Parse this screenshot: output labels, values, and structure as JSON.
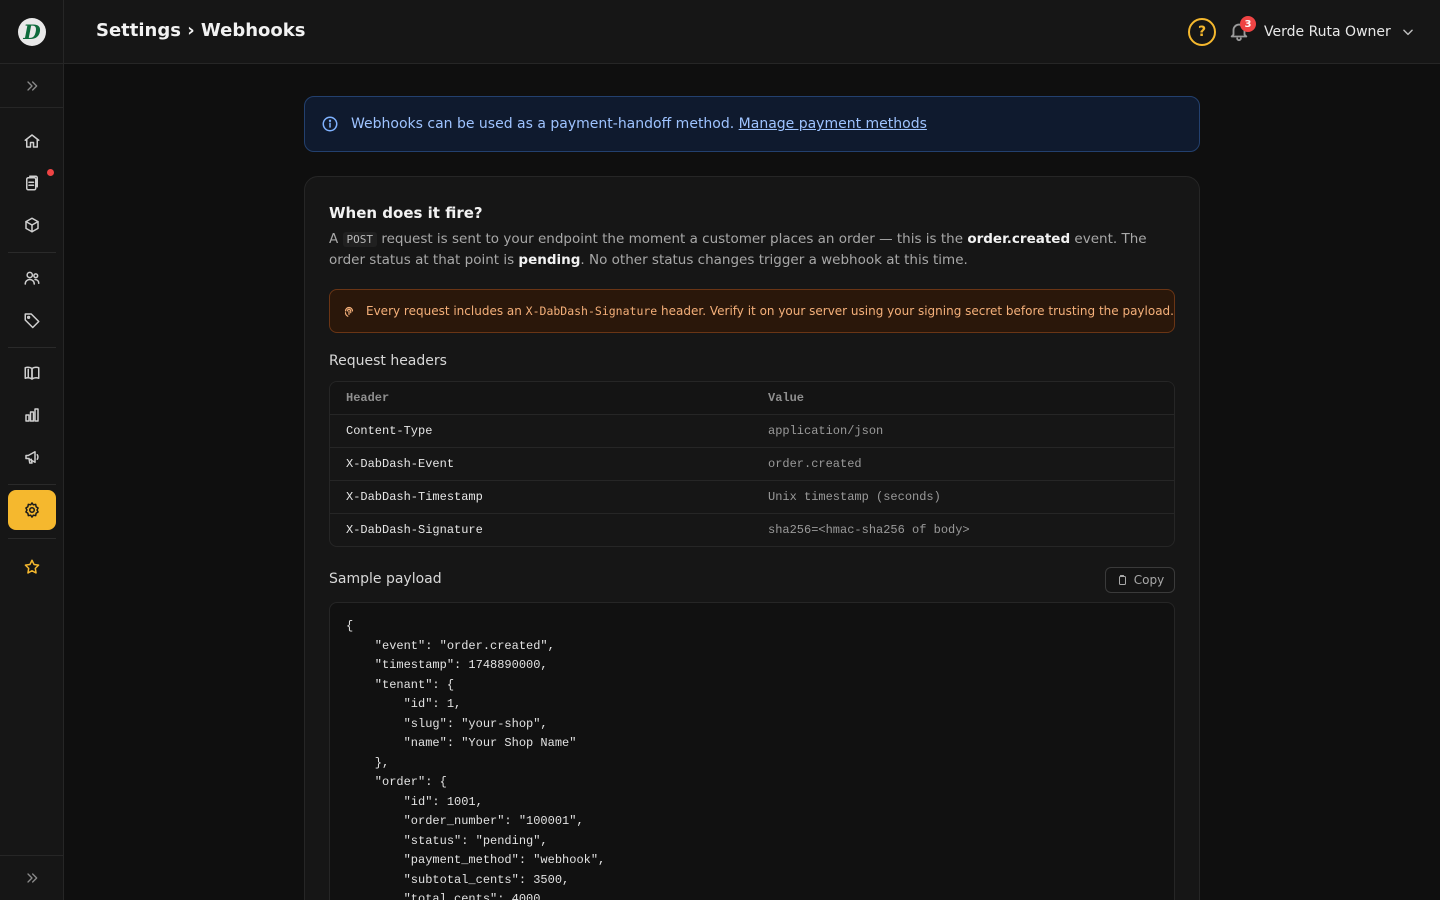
{
  "app": {
    "logo_letter": "D",
    "page_title": "Settings › Webhooks",
    "colors": {
      "accent": "#f5b82e",
      "notification": "#ef4444"
    }
  },
  "header": {
    "help_icon": "question-circle-icon",
    "notification_count": "3",
    "user_name": "Verde Ruta Owner"
  },
  "sidebar": {
    "items": [
      {
        "name": "home",
        "icon": "home-icon"
      },
      {
        "name": "orders",
        "icon": "clipboard-icon",
        "has_dot": true
      },
      {
        "name": "products",
        "icon": "box-icon"
      },
      {
        "name": "customers",
        "icon": "users-icon"
      },
      {
        "name": "discounts",
        "icon": "tag-icon"
      },
      {
        "name": "docs",
        "icon": "book-icon"
      },
      {
        "name": "analytics",
        "icon": "bar-chart-icon"
      },
      {
        "name": "marketing",
        "icon": "megaphone-icon"
      },
      {
        "name": "settings",
        "icon": "gear-icon",
        "active": true
      },
      {
        "name": "favorites",
        "icon": "star-icon"
      }
    ]
  },
  "banner": {
    "text": "Webhooks can be used as a payment-handoff method. ",
    "link": "Manage payment methods"
  },
  "fire": {
    "title": "When does it fire?",
    "desc_a": "A ",
    "desc_code": "POST",
    "desc_b": " request is sent to your endpoint the moment a customer places an order — this is the ",
    "desc_event": "order.created",
    "desc_c": " event. The order status at that point is ",
    "desc_status": "pending",
    "desc_d": ". No other status changes trigger a webhook at this time."
  },
  "warning": {
    "text_a": "Every request includes an ",
    "code": "X-DabDash-Signature",
    "text_b": " header. Verify it on your server using your signing secret before trusting the payload."
  },
  "headers_table": {
    "label": "Request headers",
    "columns": [
      "Header",
      "Value"
    ],
    "rows": [
      {
        "header": "Content-Type",
        "value": "application/json"
      },
      {
        "header": "X-DabDash-Event",
        "value": "order.created"
      },
      {
        "header": "X-DabDash-Timestamp",
        "value": "Unix timestamp (seconds)"
      },
      {
        "header": "X-DabDash-Signature",
        "value": "sha256=<hmac-sha256 of body>"
      }
    ]
  },
  "payload": {
    "label": "Sample payload",
    "copy_label": "Copy",
    "code": "{\n    \"event\": \"order.created\",\n    \"timestamp\": 1748890000,\n    \"tenant\": {\n        \"id\": 1,\n        \"slug\": \"your-shop\",\n        \"name\": \"Your Shop Name\"\n    },\n    \"order\": {\n        \"id\": 1001,\n        \"order_number\": \"100001\",\n        \"status\": \"pending\",\n        \"payment_method\": \"webhook\",\n        \"subtotal_cents\": 3500,\n        \"total_cents\": 4000,"
  }
}
